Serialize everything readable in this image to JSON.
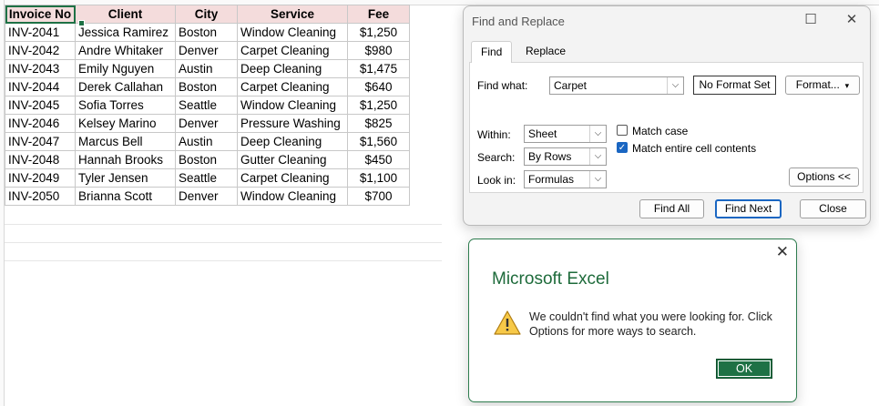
{
  "sheet": {
    "headers": [
      "Invoice No",
      "Client",
      "City",
      "Service",
      "Fee"
    ],
    "rows": [
      [
        "INV-2041",
        "Jessica Ramirez",
        "Boston",
        "Window Cleaning",
        "$1,250"
      ],
      [
        "INV-2042",
        "Andre Whitaker",
        "Denver",
        "Carpet Cleaning",
        "$980"
      ],
      [
        "INV-2043",
        "Emily Nguyen",
        "Austin",
        "Deep Cleaning",
        "$1,475"
      ],
      [
        "INV-2044",
        "Derek Callahan",
        "Boston",
        "Carpet Cleaning",
        "$640"
      ],
      [
        "INV-2045",
        "Sofia Torres",
        "Seattle",
        "Window Cleaning",
        "$1,250"
      ],
      [
        "INV-2046",
        "Kelsey Marino",
        "Denver",
        "Pressure Washing",
        "$825"
      ],
      [
        "INV-2047",
        "Marcus Bell",
        "Austin",
        "Deep Cleaning",
        "$1,560"
      ],
      [
        "INV-2048",
        "Hannah Brooks",
        "Boston",
        "Gutter Cleaning",
        "$450"
      ],
      [
        "INV-2049",
        "Tyler Jensen",
        "Seattle",
        "Carpet Cleaning",
        "$1,100"
      ],
      [
        "INV-2050",
        "Brianna Scott",
        "Denver",
        "Window Cleaning",
        "$700"
      ]
    ],
    "header_color": "#f4dcdc"
  },
  "find_dialog": {
    "title": "Find and Replace",
    "tabs": [
      "Find",
      "Replace"
    ],
    "find_what_label": "Find what:",
    "find_what_value": "Carpet",
    "no_format_label": "No Format Set",
    "format_label": "Format...",
    "within_label": "Within:",
    "within_value": "Sheet",
    "search_label": "Search:",
    "search_value": "By Rows",
    "look_in_label": "Look in:",
    "look_in_value": "Formulas",
    "match_case_label": "Match case",
    "match_case_checked": false,
    "match_entire_label": "Match entire cell contents",
    "match_entire_checked": true,
    "options_label": "Options <<",
    "find_all_label": "Find All",
    "find_next_label": "Find Next",
    "close_label": "Close"
  },
  "message_box": {
    "title": "Microsoft Excel",
    "message": "We couldn't find what you were looking for. Click Options for more ways to search.",
    "ok_label": "OK",
    "accent_color": "#1e7145"
  }
}
